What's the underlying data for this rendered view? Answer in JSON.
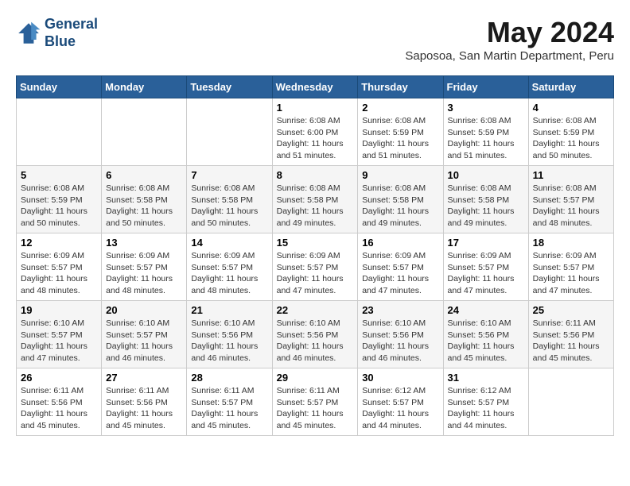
{
  "header": {
    "logo_line1": "General",
    "logo_line2": "Blue",
    "month_year": "May 2024",
    "location": "Saposoa, San Martin Department, Peru"
  },
  "days_of_week": [
    "Sunday",
    "Monday",
    "Tuesday",
    "Wednesday",
    "Thursday",
    "Friday",
    "Saturday"
  ],
  "weeks": [
    [
      {
        "day": "",
        "info": ""
      },
      {
        "day": "",
        "info": ""
      },
      {
        "day": "",
        "info": ""
      },
      {
        "day": "1",
        "info": "Sunrise: 6:08 AM\nSunset: 6:00 PM\nDaylight: 11 hours\nand 51 minutes."
      },
      {
        "day": "2",
        "info": "Sunrise: 6:08 AM\nSunset: 5:59 PM\nDaylight: 11 hours\nand 51 minutes."
      },
      {
        "day": "3",
        "info": "Sunrise: 6:08 AM\nSunset: 5:59 PM\nDaylight: 11 hours\nand 51 minutes."
      },
      {
        "day": "4",
        "info": "Sunrise: 6:08 AM\nSunset: 5:59 PM\nDaylight: 11 hours\nand 50 minutes."
      }
    ],
    [
      {
        "day": "5",
        "info": "Sunrise: 6:08 AM\nSunset: 5:59 PM\nDaylight: 11 hours\nand 50 minutes."
      },
      {
        "day": "6",
        "info": "Sunrise: 6:08 AM\nSunset: 5:58 PM\nDaylight: 11 hours\nand 50 minutes."
      },
      {
        "day": "7",
        "info": "Sunrise: 6:08 AM\nSunset: 5:58 PM\nDaylight: 11 hours\nand 50 minutes."
      },
      {
        "day": "8",
        "info": "Sunrise: 6:08 AM\nSunset: 5:58 PM\nDaylight: 11 hours\nand 49 minutes."
      },
      {
        "day": "9",
        "info": "Sunrise: 6:08 AM\nSunset: 5:58 PM\nDaylight: 11 hours\nand 49 minutes."
      },
      {
        "day": "10",
        "info": "Sunrise: 6:08 AM\nSunset: 5:58 PM\nDaylight: 11 hours\nand 49 minutes."
      },
      {
        "day": "11",
        "info": "Sunrise: 6:08 AM\nSunset: 5:57 PM\nDaylight: 11 hours\nand 48 minutes."
      }
    ],
    [
      {
        "day": "12",
        "info": "Sunrise: 6:09 AM\nSunset: 5:57 PM\nDaylight: 11 hours\nand 48 minutes."
      },
      {
        "day": "13",
        "info": "Sunrise: 6:09 AM\nSunset: 5:57 PM\nDaylight: 11 hours\nand 48 minutes."
      },
      {
        "day": "14",
        "info": "Sunrise: 6:09 AM\nSunset: 5:57 PM\nDaylight: 11 hours\nand 48 minutes."
      },
      {
        "day": "15",
        "info": "Sunrise: 6:09 AM\nSunset: 5:57 PM\nDaylight: 11 hours\nand 47 minutes."
      },
      {
        "day": "16",
        "info": "Sunrise: 6:09 AM\nSunset: 5:57 PM\nDaylight: 11 hours\nand 47 minutes."
      },
      {
        "day": "17",
        "info": "Sunrise: 6:09 AM\nSunset: 5:57 PM\nDaylight: 11 hours\nand 47 minutes."
      },
      {
        "day": "18",
        "info": "Sunrise: 6:09 AM\nSunset: 5:57 PM\nDaylight: 11 hours\nand 47 minutes."
      }
    ],
    [
      {
        "day": "19",
        "info": "Sunrise: 6:10 AM\nSunset: 5:57 PM\nDaylight: 11 hours\nand 47 minutes."
      },
      {
        "day": "20",
        "info": "Sunrise: 6:10 AM\nSunset: 5:57 PM\nDaylight: 11 hours\nand 46 minutes."
      },
      {
        "day": "21",
        "info": "Sunrise: 6:10 AM\nSunset: 5:56 PM\nDaylight: 11 hours\nand 46 minutes."
      },
      {
        "day": "22",
        "info": "Sunrise: 6:10 AM\nSunset: 5:56 PM\nDaylight: 11 hours\nand 46 minutes."
      },
      {
        "day": "23",
        "info": "Sunrise: 6:10 AM\nSunset: 5:56 PM\nDaylight: 11 hours\nand 46 minutes."
      },
      {
        "day": "24",
        "info": "Sunrise: 6:10 AM\nSunset: 5:56 PM\nDaylight: 11 hours\nand 45 minutes."
      },
      {
        "day": "25",
        "info": "Sunrise: 6:11 AM\nSunset: 5:56 PM\nDaylight: 11 hours\nand 45 minutes."
      }
    ],
    [
      {
        "day": "26",
        "info": "Sunrise: 6:11 AM\nSunset: 5:56 PM\nDaylight: 11 hours\nand 45 minutes."
      },
      {
        "day": "27",
        "info": "Sunrise: 6:11 AM\nSunset: 5:56 PM\nDaylight: 11 hours\nand 45 minutes."
      },
      {
        "day": "28",
        "info": "Sunrise: 6:11 AM\nSunset: 5:57 PM\nDaylight: 11 hours\nand 45 minutes."
      },
      {
        "day": "29",
        "info": "Sunrise: 6:11 AM\nSunset: 5:57 PM\nDaylight: 11 hours\nand 45 minutes."
      },
      {
        "day": "30",
        "info": "Sunrise: 6:12 AM\nSunset: 5:57 PM\nDaylight: 11 hours\nand 44 minutes."
      },
      {
        "day": "31",
        "info": "Sunrise: 6:12 AM\nSunset: 5:57 PM\nDaylight: 11 hours\nand 44 minutes."
      },
      {
        "day": "",
        "info": ""
      }
    ]
  ]
}
